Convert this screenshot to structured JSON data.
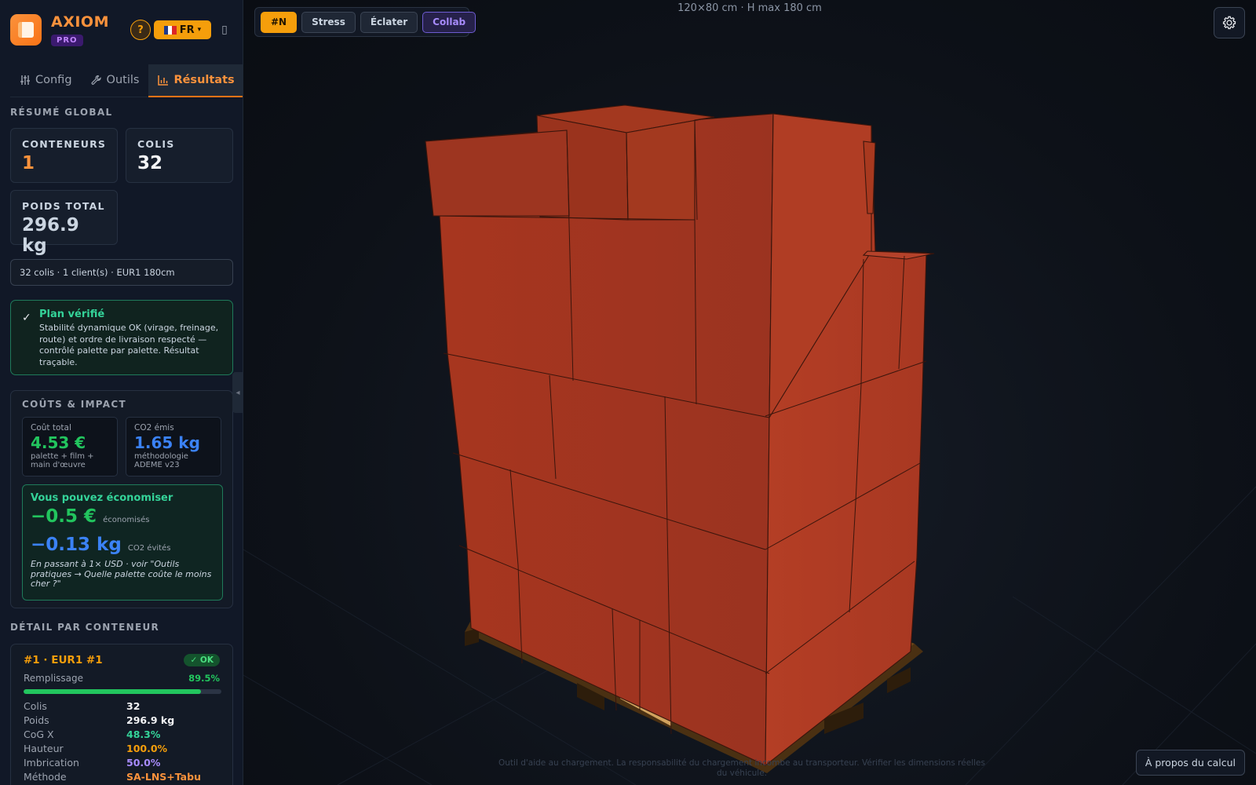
{
  "brand": {
    "name": "AXIOM",
    "badge": "PRO"
  },
  "header": {
    "help_label": "?",
    "lang_label": "FR",
    "lang_caret": "▾"
  },
  "tabs": [
    {
      "label": "Config",
      "icon": "sliders-icon"
    },
    {
      "label": "Outils",
      "icon": "wrench-icon"
    },
    {
      "label": "Résultats",
      "icon": "bar-chart-icon"
    }
  ],
  "summary": {
    "title": "RÉSUMÉ GLOBAL",
    "containers_label": "CONTENEURS",
    "containers_value": "1",
    "parcels_label": "COLIS",
    "parcels_value": "32",
    "weight_label": "POIDS TOTAL",
    "weight_value": "296.9 kg",
    "info_line": "32 colis · 1 client(s) · EUR1 180cm"
  },
  "verified": {
    "title": "Plan vérifié",
    "text": "Stabilité dynamique OK (virage, freinage, route) et ordre de livraison respecté — contrôlé palette par palette. Résultat traçable."
  },
  "costs": {
    "title": "COÛTS & IMPACT",
    "total_label": "Coût total",
    "total_value": "4.53 €",
    "total_note": "palette + film + main d'œuvre",
    "co2_label": "CO2 émis",
    "co2_value": "1.65 kg",
    "co2_note": "méthodologie ADEME v23",
    "saving_title": "Vous pouvez économiser",
    "saving_eur": "−0.5 €",
    "saving_eur_unit": "économisés",
    "saving_co2": "−0.13 kg",
    "saving_co2_unit": "CO2 évités",
    "saving_note": "En passant à 1× USD · voir \"Outils pratiques → Quelle palette coûte le moins cher ?\""
  },
  "detail": {
    "title": "DÉTAIL PAR CONTENEUR",
    "card_title": "#1 · EUR1 #1",
    "status": "✓ OK",
    "fill_label": "Remplissage",
    "fill_value": "89.5%",
    "fill_fraction": 0.895,
    "rows": [
      {
        "k": "Colis",
        "v": "32",
        "color": "#f3f4f6"
      },
      {
        "k": "Poids",
        "v": "296.9 kg",
        "color": "#f3f4f6"
      },
      {
        "k": "CoG X",
        "v": "48.3%",
        "color": "#34d399"
      },
      {
        "k": "Hauteur",
        "v": "100.0%",
        "color": "#f59e0b"
      },
      {
        "k": "Imbrication",
        "v": "50.0%",
        "color": "#a78bfa"
      },
      {
        "k": "Méthode",
        "v": "SA-LNS+Tabu",
        "color": "#fb923c"
      }
    ]
  },
  "viewport": {
    "caption": "120×80 cm · H max 180 cm",
    "toolbar": {
      "n": "#N",
      "stress": "Stress",
      "explode": "Éclater",
      "collab": "Collab"
    },
    "about_label": "À propos du calcul",
    "disclaimer": "Outil d'aide au chargement. La responsabilité du chargement incombe au transporteur. Vérifier les dimensions réelles du véhicule."
  },
  "colors": {
    "accent": "#f97316",
    "ok": "#22c55e",
    "box": "#b8432a",
    "pallet": "#6b4518"
  }
}
